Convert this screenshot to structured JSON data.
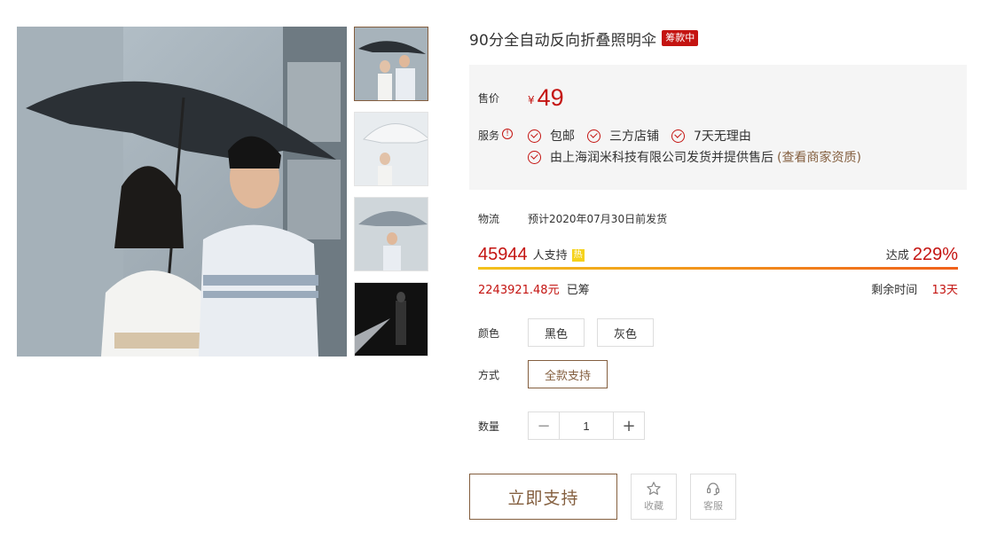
{
  "product": {
    "title": "90分全自动反向折叠照明伞",
    "status_tag": "筹款中"
  },
  "price": {
    "label": "售价",
    "currency": "¥",
    "value": "49"
  },
  "service": {
    "label": "服务",
    "info_icon_text": "!",
    "items": [
      "包邮",
      "三方店铺",
      "7天无理由"
    ],
    "seller_note": "由上海润米科技有限公司发货并提供售后",
    "seller_link": "(查看商家资质)"
  },
  "shipping": {
    "label": "物流",
    "text": "预计2020年07月30日前发货"
  },
  "funding": {
    "backers": "45944",
    "backers_text": "人支持",
    "hot_badge": "热",
    "achieve_label": "达成",
    "achieve_value": "229%",
    "progress_fraction": 1.0,
    "raised": "2243921.48元",
    "raised_label": "已筹",
    "remaining_label": "剩余时间",
    "remaining_value": "13天"
  },
  "options": {
    "color_label": "颜色",
    "colors": [
      "黑色",
      "灰色"
    ],
    "mode_label": "方式",
    "modes": [
      "全款支持"
    ]
  },
  "quantity": {
    "label": "数量",
    "minus": "−",
    "value": "1",
    "plus": "+"
  },
  "actions": {
    "support": "立即支持",
    "favorite": "收藏",
    "customer_service": "客服"
  },
  "colors": {
    "accent_red": "#c41411",
    "brand_brown": "#845f3f",
    "price_box_bg": "#f5f5f5"
  }
}
